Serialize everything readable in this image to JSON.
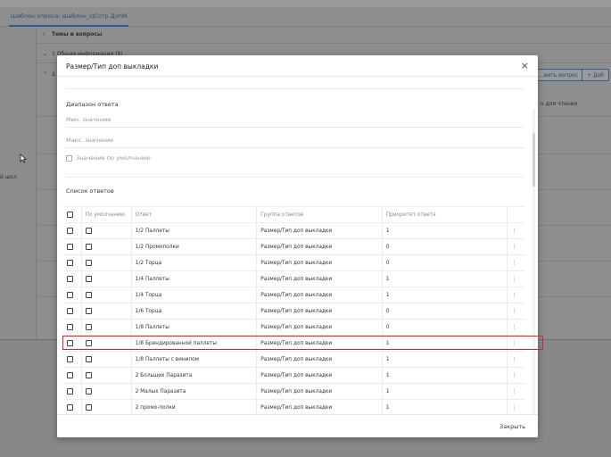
{
  "background": {
    "tab_label": "Шаблон опроса: Шаблон_ЦСотр ДопМ",
    "section_header": "Темы и вопросы",
    "group_1": "1 Общая информация (8)",
    "group_2_prefix": "2",
    "add_question_button": "...вить вопрос",
    "add_button": "+  Доб",
    "readonly_col": "о для чтения",
    "left_label": "й шол"
  },
  "modal": {
    "title": "Размер/Тип доп выкладки",
    "close_icon": "×",
    "range_section": "Диапазон ответа",
    "min_placeholder": "Мин. значение",
    "max_placeholder": "Макс. значение",
    "default_value_label": "Значение по умолчанию",
    "answers_section": "Список ответов",
    "columns": {
      "default": "По умолчанию",
      "answer": "Ответ",
      "group": "Группа ответов",
      "priority": "Приоритет ответа"
    },
    "rows": [
      {
        "answer": "1/2 Паллеты",
        "group": "Размер/Тип доп выкладки",
        "priority": "1"
      },
      {
        "answer": "1/2 Промополки",
        "group": "Размер/Тип доп выкладки",
        "priority": "0"
      },
      {
        "answer": "1/2 Торца",
        "group": "Размер/Тип доп выкладки",
        "priority": "0"
      },
      {
        "answer": "1/4 Паллеты",
        "group": "Размер/Тип доп выкладки",
        "priority": "1"
      },
      {
        "answer": "1/4 Торца",
        "group": "Размер/Тип доп выкладки",
        "priority": "1"
      },
      {
        "answer": "1/6 Торца",
        "group": "Размер/Тип доп выкладки",
        "priority": "0"
      },
      {
        "answer": "1/8 Паллеты",
        "group": "Размер/Тип доп выкладки",
        "priority": "0"
      },
      {
        "answer": "1/8 Брендированной паллеты",
        "group": "Размер/Тип доп выкладки",
        "priority": "1"
      },
      {
        "answer": "1/8 Паллеты с винилом",
        "group": "Размер/Тип доп выкладки",
        "priority": "1"
      },
      {
        "answer": "2 Больших Паразита",
        "group": "Размер/Тип доп выкладки",
        "priority": "1"
      },
      {
        "answer": "2 Малых Паразита",
        "group": "Размер/Тип доп выкладки",
        "priority": "1"
      },
      {
        "answer": "2 промо-полки",
        "group": "Размер/Тип доп выкладки",
        "priority": "1"
      }
    ],
    "row_menu_icon": "⋮",
    "footer_close": "Закрыть"
  },
  "colors": {
    "highlight": "#d9262a",
    "accent": "#2c5f9a"
  }
}
